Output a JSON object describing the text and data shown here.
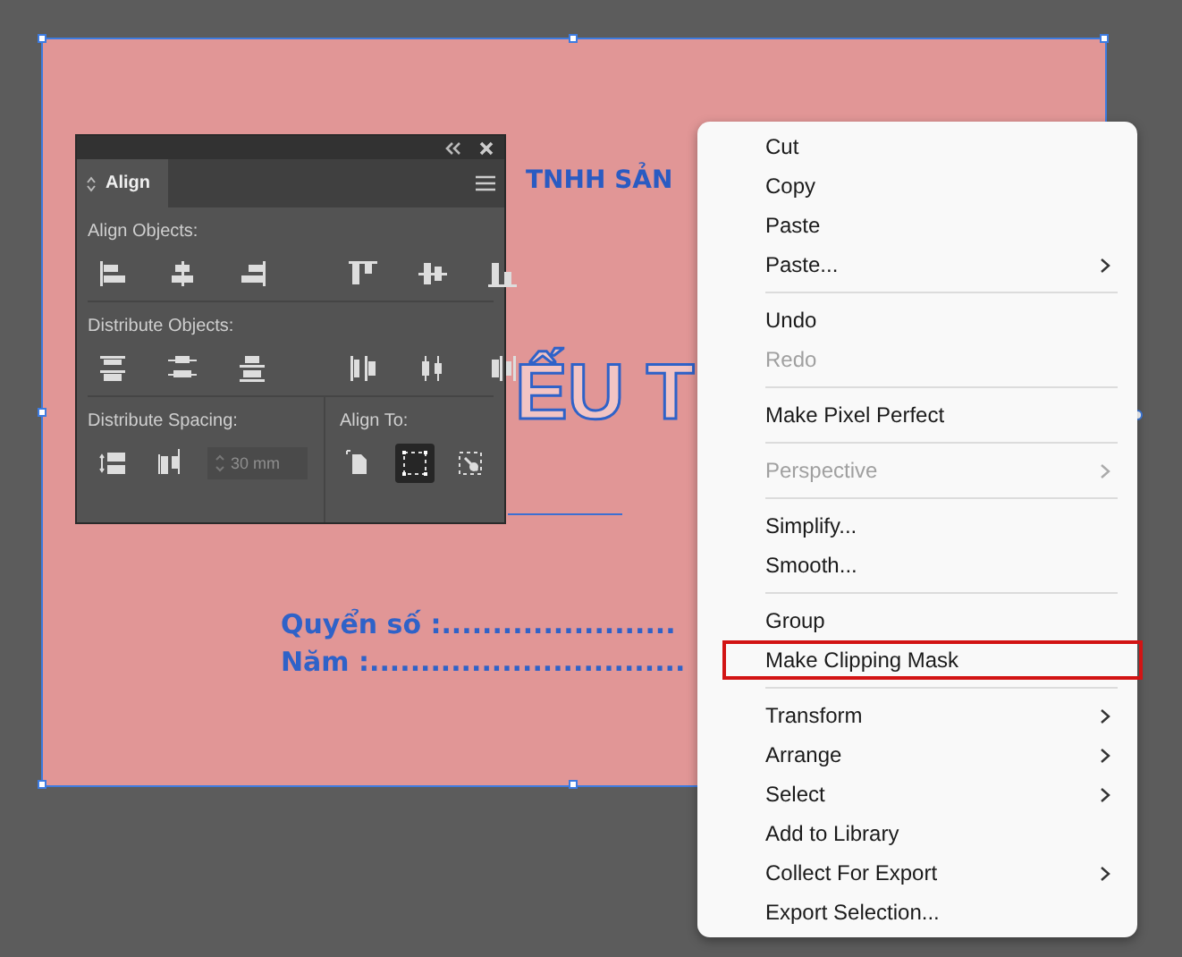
{
  "artboard": {
    "texts": [
      {
        "kind": "heading",
        "text": "TNHH SẢN"
      },
      {
        "kind": "title",
        "text": "ẾU T"
      },
      {
        "kind": "line",
        "text": "Quyển số :......................."
      },
      {
        "kind": "line",
        "text": "Năm :..............................."
      }
    ]
  },
  "align_panel": {
    "tab": "Align",
    "sections": [
      {
        "label": "Align Objects:"
      },
      {
        "label": "Distribute Objects:"
      }
    ],
    "spacing": {
      "label": "Distribute Spacing:",
      "value": "30 mm",
      "disabled": true
    },
    "align_to": {
      "label": "Align To:",
      "options": [
        {
          "selected": false
        },
        {
          "selected": true
        },
        {
          "selected": false
        }
      ]
    }
  },
  "context_menu": {
    "groups": [
      [
        {
          "label": "Cut",
          "disabled": false,
          "submenu": false,
          "highlighted": false
        },
        {
          "label": "Copy",
          "disabled": false,
          "submenu": false,
          "highlighted": false
        },
        {
          "label": "Paste",
          "disabled": false,
          "submenu": false,
          "highlighted": false
        },
        {
          "label": "Paste...",
          "disabled": false,
          "submenu": true,
          "highlighted": false
        }
      ],
      [
        {
          "label": "Undo",
          "disabled": false,
          "submenu": false,
          "highlighted": false
        },
        {
          "label": "Redo",
          "disabled": true,
          "submenu": false,
          "highlighted": false
        }
      ],
      [
        {
          "label": "Make Pixel Perfect",
          "disabled": false,
          "submenu": false,
          "highlighted": false
        }
      ],
      [
        {
          "label": "Perspective",
          "disabled": true,
          "submenu": true,
          "highlighted": false
        }
      ],
      [
        {
          "label": "Simplify...",
          "disabled": false,
          "submenu": false,
          "highlighted": false
        },
        {
          "label": "Smooth...",
          "disabled": false,
          "submenu": false,
          "highlighted": false
        }
      ],
      [
        {
          "label": "Group",
          "disabled": false,
          "submenu": false,
          "highlighted": false
        },
        {
          "label": "Make Clipping Mask",
          "disabled": false,
          "submenu": false,
          "highlighted": true
        }
      ],
      [
        {
          "label": "Transform",
          "disabled": false,
          "submenu": true,
          "highlighted": false
        },
        {
          "label": "Arrange",
          "disabled": false,
          "submenu": true,
          "highlighted": false
        },
        {
          "label": "Select",
          "disabled": false,
          "submenu": true,
          "highlighted": false
        },
        {
          "label": "Add to Library",
          "disabled": false,
          "submenu": false,
          "highlighted": false
        },
        {
          "label": "Collect For Export",
          "disabled": false,
          "submenu": true,
          "highlighted": false
        },
        {
          "label": "Export Selection...",
          "disabled": false,
          "submenu": false,
          "highlighted": false
        }
      ]
    ]
  }
}
